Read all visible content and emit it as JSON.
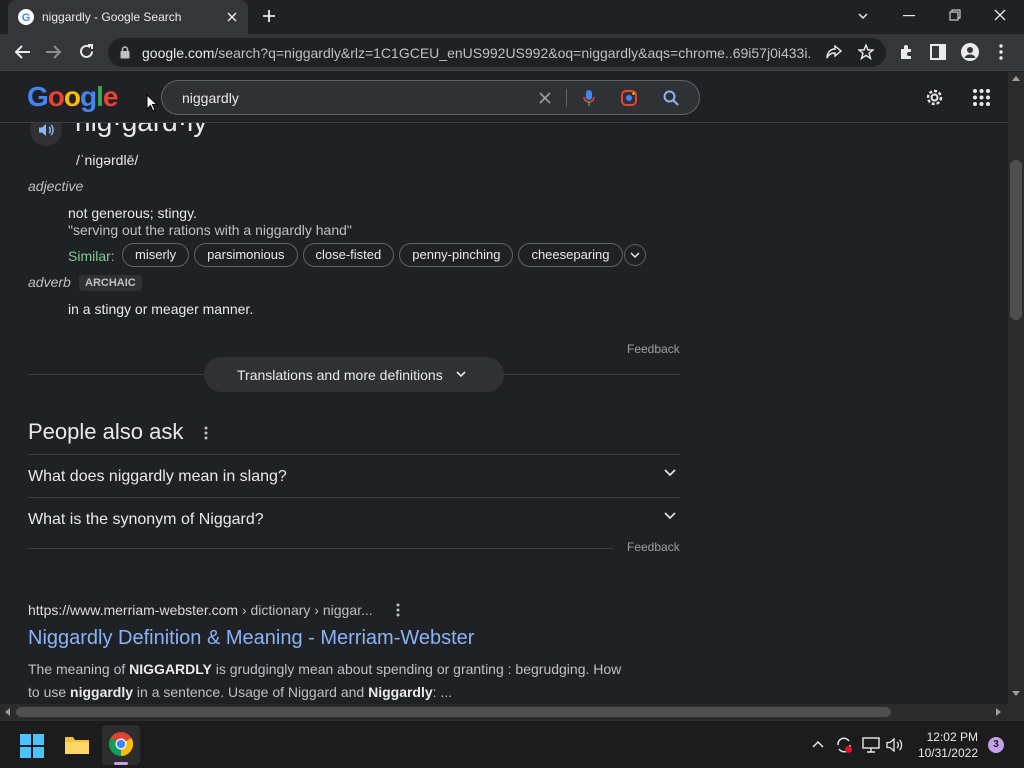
{
  "tab": {
    "title": "niggardly - Google Search"
  },
  "toolbar": {
    "url_host": "google.com",
    "url_rest": "/search?q=niggardly&rlz=1C1GCEU_enUS992US992&oq=niggardly&aqs=chrome..69i57j0i433i..."
  },
  "header": {
    "logo_letters": [
      "G",
      "o",
      "o",
      "g",
      "l",
      "e"
    ],
    "query": "niggardly"
  },
  "dictionary": {
    "word": "nig·gard·ly",
    "phonetic": "/ˈniɡərdlē/",
    "pos_1": "adjective",
    "def_1": "not generous; stingy.",
    "example_1": "\"serving out the rations with a niggardly hand\"",
    "similar_label": "Similar:",
    "similar": [
      "miserly",
      "parsimonious",
      "close-fisted",
      "penny-pinching",
      "cheeseparing"
    ],
    "pos_2": "adverb",
    "archaic_badge": "ARCHAIC",
    "def_2": "in a stingy or meager manner.",
    "feedback": "Feedback",
    "more_button": "Translations and more definitions"
  },
  "paa": {
    "title": "People also ask",
    "questions": [
      "What does niggardly mean in slang?",
      "What is the synonym of Niggard?"
    ],
    "feedback": "Feedback"
  },
  "result": {
    "cite_url": "https://www.merriam-webster.com",
    "cite_path": " › dictionary › niggar...",
    "title": "Niggardly Definition & Meaning - Merriam-Webster",
    "snippet_1a": "The meaning of ",
    "snippet_1b": "NIGGARDLY",
    "snippet_1c": " is grudgingly mean about spending or granting : begrudging. How",
    "snippet_2a": "to use ",
    "snippet_2b": "niggardly",
    "snippet_2c": " in a sentence. Usage of Niggard and ",
    "snippet_2d": "Niggardly",
    "snippet_2e": ": ..."
  },
  "taskbar": {
    "time": "12:02 PM",
    "date": "10/31/2022",
    "notification_count": "3"
  },
  "colors": {
    "accent_link": "#8ab4f8",
    "similar_green": "#81c995",
    "page_bg": "#202124"
  }
}
